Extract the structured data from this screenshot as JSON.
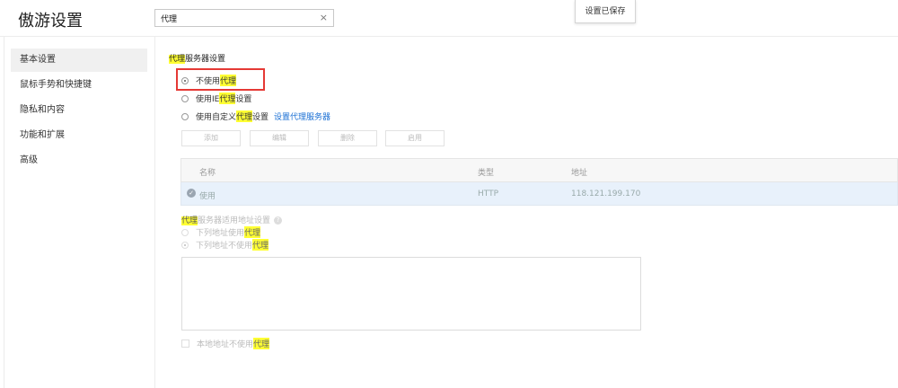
{
  "app": {
    "title": "傲游设置"
  },
  "search": {
    "value": "代理",
    "clear_icon": "×"
  },
  "toast": {
    "text": "设置已保存"
  },
  "sidebar": {
    "items": [
      {
        "label": "基本设置"
      },
      {
        "label": "鼠标手势和快捷键"
      },
      {
        "label": "隐私和内容"
      },
      {
        "label": "功能和扩展"
      },
      {
        "label": "高级"
      }
    ]
  },
  "proxy": {
    "title_pre": "代理",
    "title_post": "服务器设置",
    "opt_none": {
      "pre": "不使用",
      "hl": "代理"
    },
    "opt_ie": {
      "pre": "使用IE",
      "hl": "代理",
      "post": "设置"
    },
    "opt_custom": {
      "pre": "使用自定义",
      "hl": "代理",
      "post": "设置",
      "link": "设置代理服务器"
    },
    "buttons": {
      "add": "添加",
      "edit": "编辑",
      "delete": "删除",
      "enable": "启用"
    },
    "table": {
      "headers": {
        "name": "名称",
        "type": "类型",
        "address": "地址"
      },
      "rows": [
        {
          "name": "使用",
          "type": "HTTP",
          "address": "118.121.199.170"
        }
      ]
    },
    "apply": {
      "title_hl": "代理",
      "title_post": "服务器适用地址设置",
      "help_icon": "?",
      "opt_use": {
        "pre": "下列地址使用",
        "hl": "代理"
      },
      "opt_nouse": {
        "pre": "下列地址不使用",
        "hl": "代理"
      }
    },
    "local": {
      "pre": "本地地址不使用",
      "hl": "代理"
    }
  }
}
